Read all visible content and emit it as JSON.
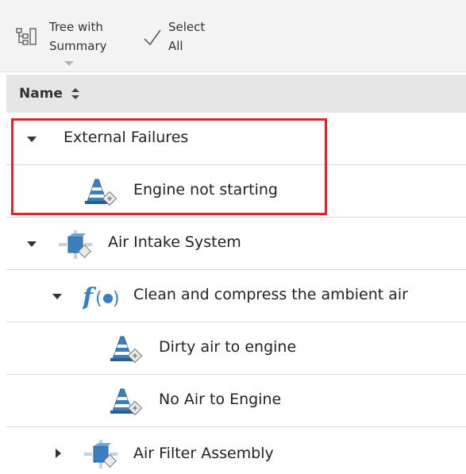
{
  "toolbar": {
    "tree_summary_line1": "Tree with",
    "tree_summary_line2": "Summary",
    "select_all_line1": "Select",
    "select_all_line2": "All"
  },
  "table": {
    "column_header": "Name"
  },
  "rows": [
    {
      "label": "External Failures",
      "icon": "none",
      "expanded": true
    },
    {
      "label": "Engine not starting",
      "icon": "failure-cone-icon"
    },
    {
      "label": "Air Intake System",
      "icon": "system-component-icon",
      "expanded": true
    },
    {
      "label": "Clean and compress the ambient air",
      "icon": "function-icon",
      "expanded": true
    },
    {
      "label": "Dirty air to engine",
      "icon": "failure-cone-icon"
    },
    {
      "label": "No Air to Engine",
      "icon": "failure-cone-icon"
    },
    {
      "label": "Air Filter Assembly",
      "icon": "system-component-icon",
      "expanded": false
    }
  ],
  "colors": {
    "highlight_border": "#e8202a",
    "header_bg": "#e6e6e6",
    "toolbar_bg": "#f3f3f3",
    "icon_blue": "#3a7fc0"
  }
}
